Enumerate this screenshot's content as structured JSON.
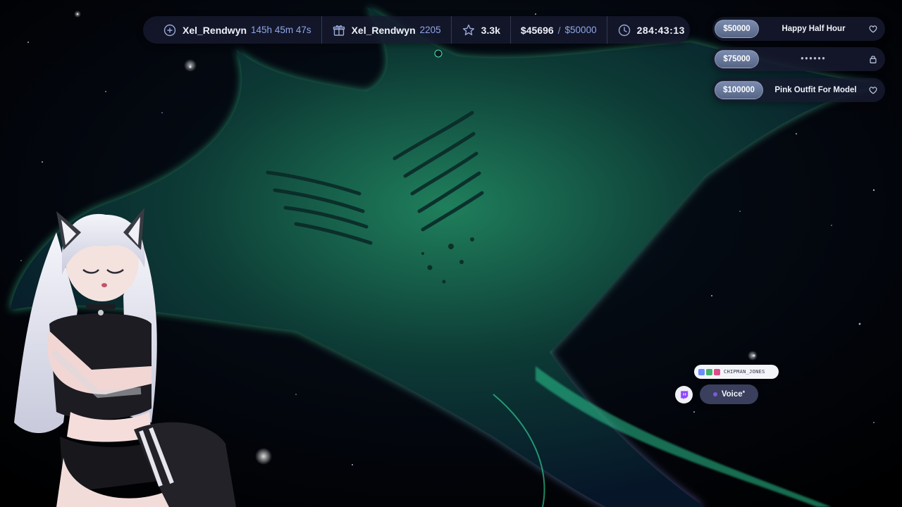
{
  "topbar": {
    "stats": [
      {
        "icon": "follower-plus-icon",
        "title": "Xel_Rendwyn",
        "aside": "145h 45m 47s"
      },
      {
        "icon": "gift-icon",
        "title": "Xel_Rendwyn",
        "aside": "2205"
      },
      {
        "icon": "star-icon",
        "title": "3.3k"
      },
      {
        "icon": "money-goal",
        "current": "$45696",
        "separator": "/",
        "target": "$50000"
      },
      {
        "icon": "clock-icon",
        "title": "284:43:13"
      }
    ]
  },
  "goals": [
    {
      "amount": "$50000",
      "label": "Happy Half Hour",
      "status_icon": "heart-icon"
    },
    {
      "amount": "$75000",
      "label": "••••••",
      "status_icon": "lock-icon"
    },
    {
      "amount": "$100000",
      "label": "Pink Outfit For Model",
      "status_icon": "heart-icon"
    }
  ],
  "chat": {
    "username": "CHIPMAN_JONES",
    "voice_label": "Voice",
    "voice_mark": "*"
  },
  "colors": {
    "accent": "#8fa6e8",
    "panel": "#161a2e",
    "aurora_green": "#3fe8a0",
    "aurora_purple": "#8a5cf0",
    "twitch": "#9146ff"
  }
}
